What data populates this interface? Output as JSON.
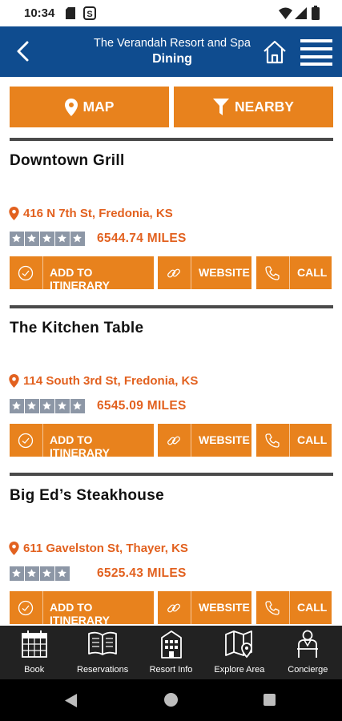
{
  "status_bar": {
    "time": "10:34",
    "icons": [
      "sim-card-icon",
      "s-app-icon",
      "wifi-icon",
      "signal-icon",
      "battery-icon"
    ]
  },
  "header": {
    "title": "The Verandah Resort and Spa",
    "subtitle": "Dining",
    "icons": [
      "back-arrow-icon",
      "home-icon",
      "hamburger-menu-icon"
    ]
  },
  "actions": {
    "map": "MAP",
    "nearby": "NEARBY"
  },
  "listings": [
    {
      "name": "Downtown Grill",
      "address": "416 N 7th St, Fredonia, KS",
      "rating": 5,
      "distance": "6544.74 MILES",
      "buttons": {
        "itinerary": "ADD TO ITINERARY",
        "website": "WEBSITE",
        "call": "CALL"
      }
    },
    {
      "name": "The Kitchen Table",
      "address": "114 South 3rd St, Fredonia, KS",
      "rating": 5,
      "distance": "6545.09 MILES",
      "buttons": {
        "itinerary": "ADD TO ITINERARY",
        "website": "WEBSITE",
        "call": "CALL"
      }
    },
    {
      "name": "Big Ed’s Steakhouse",
      "address": "611 Gavelston St, Thayer, KS",
      "rating": 4,
      "distance": "6525.43 MILES",
      "buttons": {
        "itinerary": "ADD TO ITINERARY",
        "website": "WEBSITE",
        "call": "CALL"
      }
    }
  ],
  "bottom_nav": [
    {
      "label": "Book",
      "icon": "calendar-icon"
    },
    {
      "label": "Reservations",
      "icon": "open-book-icon"
    },
    {
      "label": "Resort Info",
      "icon": "building-icon"
    },
    {
      "label": "Explore Area",
      "icon": "map-pin-icon"
    },
    {
      "label": "Concierge",
      "icon": "concierge-icon"
    }
  ],
  "colors": {
    "header": "#0f4c8f",
    "accent": "#e8821d",
    "address": "#e2611f",
    "star_box": "#8d97a6",
    "nav_bg": "#222222"
  }
}
